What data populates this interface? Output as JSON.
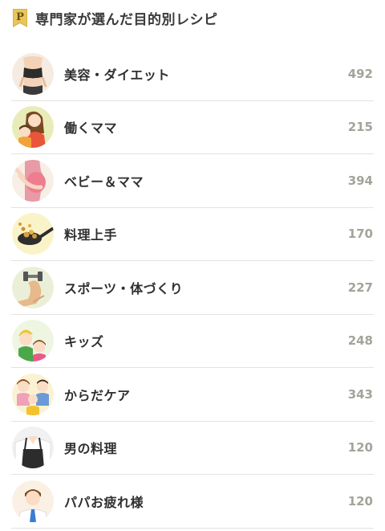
{
  "header": {
    "title": "専門家が選んだ目的別レシピ",
    "badge_letter": "P"
  },
  "categories": [
    {
      "label": "美容・ダイエット",
      "count": "492",
      "icon": "diet-woman-icon"
    },
    {
      "label": "働くママ",
      "count": "215",
      "icon": "working-mom-icon"
    },
    {
      "label": "ベビー＆ママ",
      "count": "394",
      "icon": "pregnant-mom-icon"
    },
    {
      "label": "料理上手",
      "count": "170",
      "icon": "frying-pan-icon"
    },
    {
      "label": "スポーツ・体づくり",
      "count": "227",
      "icon": "muscle-dumbbell-icon"
    },
    {
      "label": "キッズ",
      "count": "248",
      "icon": "kids-icon"
    },
    {
      "label": "からだケア",
      "count": "343",
      "icon": "family-icon"
    },
    {
      "label": "男の料理",
      "count": "120",
      "icon": "man-apron-icon"
    },
    {
      "label": "パパお疲れ様",
      "count": "120",
      "icon": "salaryman-icon"
    }
  ]
}
